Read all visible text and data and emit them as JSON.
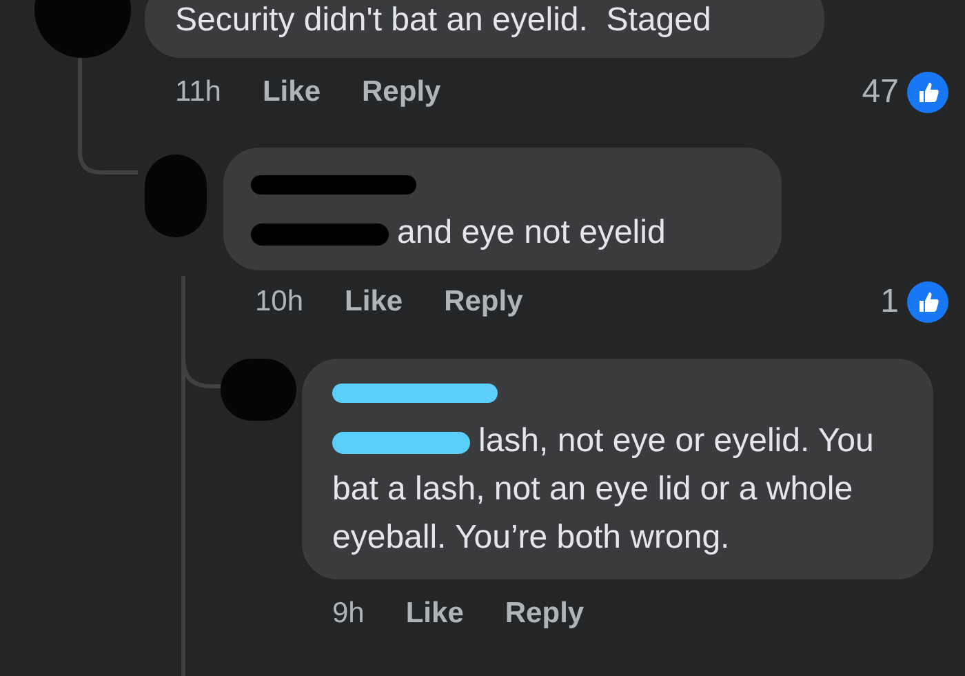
{
  "comments": [
    {
      "kind": "top",
      "body": "Security didn't bat an eyelid.  Staged",
      "time": "11h",
      "actions": [
        "Like",
        "Reply"
      ],
      "reactions": "47"
    },
    {
      "kind": "reply",
      "body": "and eye not eyelid",
      "time": "10h",
      "actions": [
        "Like",
        "Reply"
      ],
      "reactions": "1",
      "redacted": true
    },
    {
      "kind": "nested",
      "body": "lash, not eye or eyelid. You bat a lash, not an eye lid or a whole eyeball. You’re both wrong.",
      "time": "9h",
      "actions": [
        "Like",
        "Reply"
      ],
      "redacted": true
    }
  ]
}
